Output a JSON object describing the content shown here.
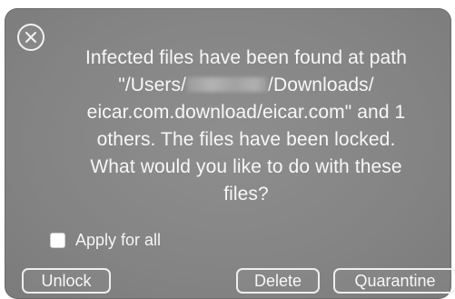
{
  "dialog": {
    "message_lines": [
      "Infected files have been found at path",
      "\"/Users/",
      "/Downloads/",
      "eicar.com.download/eicar.com\" and 1",
      "others. The files have been locked.",
      "What would you like to do with these",
      "files?"
    ],
    "apply_all_label": "Apply for all",
    "apply_all_checked": false,
    "buttons": {
      "unlock": "Unlock",
      "delete": "Delete",
      "quarantine": "Quarantine"
    },
    "icons": {
      "close": "close-icon"
    },
    "colors": {
      "background": "#858585",
      "text": "#f7f7f7",
      "border": "#eeeeee"
    }
  }
}
